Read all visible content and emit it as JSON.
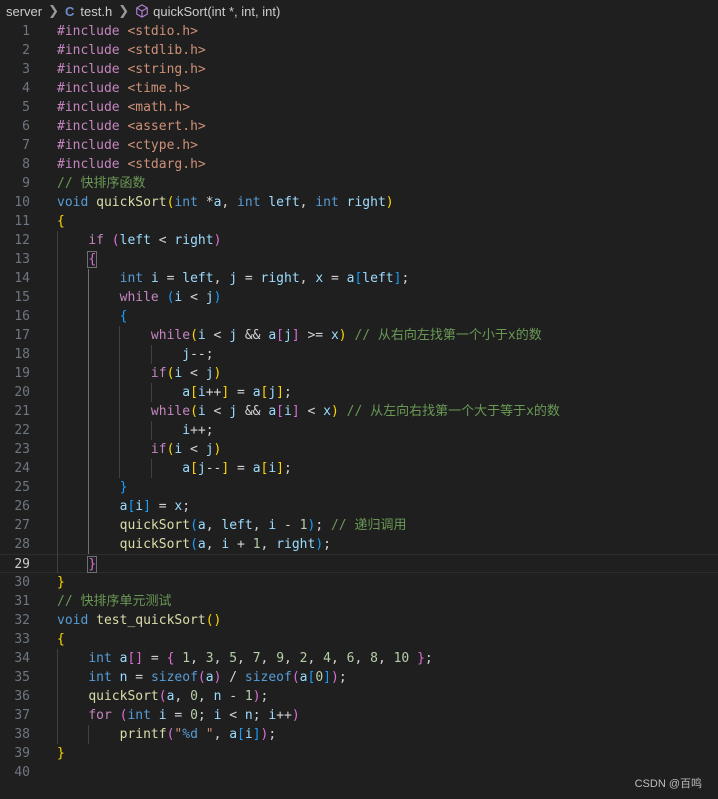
{
  "breadcrumb": {
    "folder": "server",
    "file_icon": "C",
    "file": "test.h",
    "symbol": "quickSort(int *, int, int)"
  },
  "current_line": 29,
  "lines": [
    {
      "n": "1",
      "tokens": [
        [
          "pre",
          "#include"
        ],
        [
          "op",
          " "
        ],
        [
          "inc",
          "<stdio.h>"
        ]
      ]
    },
    {
      "n": "2",
      "tokens": [
        [
          "pre",
          "#include"
        ],
        [
          "op",
          " "
        ],
        [
          "inc",
          "<stdlib.h>"
        ]
      ]
    },
    {
      "n": "3",
      "tokens": [
        [
          "pre",
          "#include"
        ],
        [
          "op",
          " "
        ],
        [
          "inc",
          "<string.h>"
        ]
      ]
    },
    {
      "n": "4",
      "tokens": [
        [
          "pre",
          "#include"
        ],
        [
          "op",
          " "
        ],
        [
          "inc",
          "<time.h>"
        ]
      ]
    },
    {
      "n": "5",
      "tokens": [
        [
          "pre",
          "#include"
        ],
        [
          "op",
          " "
        ],
        [
          "inc",
          "<math.h>"
        ]
      ]
    },
    {
      "n": "6",
      "tokens": [
        [
          "pre",
          "#include"
        ],
        [
          "op",
          " "
        ],
        [
          "inc",
          "<assert.h>"
        ]
      ]
    },
    {
      "n": "7",
      "tokens": [
        [
          "pre",
          "#include"
        ],
        [
          "op",
          " "
        ],
        [
          "inc",
          "<ctype.h>"
        ]
      ]
    },
    {
      "n": "8",
      "tokens": [
        [
          "pre",
          "#include"
        ],
        [
          "op",
          " "
        ],
        [
          "inc",
          "<stdarg.h>"
        ]
      ]
    },
    {
      "n": "9",
      "tokens": [
        [
          "cmt",
          "// 快排序函数"
        ]
      ]
    },
    {
      "n": "10",
      "tokens": [
        [
          "kw",
          "void"
        ],
        [
          "op",
          " "
        ],
        [
          "fn",
          "quickSort"
        ],
        [
          "b1",
          "("
        ],
        [
          "kw",
          "int"
        ],
        [
          "op",
          " *"
        ],
        [
          "var",
          "a"
        ],
        [
          "op",
          ", "
        ],
        [
          "kw",
          "int"
        ],
        [
          "op",
          " "
        ],
        [
          "var",
          "left"
        ],
        [
          "op",
          ", "
        ],
        [
          "kw",
          "int"
        ],
        [
          "op",
          " "
        ],
        [
          "var",
          "right"
        ],
        [
          "b1",
          ")"
        ]
      ]
    },
    {
      "n": "11",
      "tokens": [
        [
          "b1",
          "{"
        ]
      ]
    },
    {
      "n": "12",
      "tokens": [
        [
          "op",
          "    "
        ],
        [
          "ctl",
          "if"
        ],
        [
          "op",
          " "
        ],
        [
          "b2",
          "("
        ],
        [
          "var",
          "left"
        ],
        [
          "op",
          " < "
        ],
        [
          "var",
          "right"
        ],
        [
          "b2",
          ")"
        ]
      ]
    },
    {
      "n": "13",
      "tokens": [
        [
          "op",
          "    "
        ],
        [
          "b2box",
          "{"
        ]
      ]
    },
    {
      "n": "14",
      "tokens": [
        [
          "op",
          "        "
        ],
        [
          "kw",
          "int"
        ],
        [
          "op",
          " "
        ],
        [
          "var",
          "i"
        ],
        [
          "op",
          " = "
        ],
        [
          "var",
          "left"
        ],
        [
          "op",
          ", "
        ],
        [
          "var",
          "j"
        ],
        [
          "op",
          " = "
        ],
        [
          "var",
          "right"
        ],
        [
          "op",
          ", "
        ],
        [
          "var",
          "x"
        ],
        [
          "op",
          " = "
        ],
        [
          "var",
          "a"
        ],
        [
          "b3",
          "["
        ],
        [
          "var",
          "left"
        ],
        [
          "b3",
          "]"
        ],
        [
          "op",
          ";"
        ]
      ]
    },
    {
      "n": "15",
      "tokens": [
        [
          "op",
          "        "
        ],
        [
          "ctl",
          "while"
        ],
        [
          "op",
          " "
        ],
        [
          "b3",
          "("
        ],
        [
          "var",
          "i"
        ],
        [
          "op",
          " < "
        ],
        [
          "var",
          "j"
        ],
        [
          "b3",
          ")"
        ]
      ]
    },
    {
      "n": "16",
      "tokens": [
        [
          "op",
          "        "
        ],
        [
          "b3",
          "{"
        ]
      ]
    },
    {
      "n": "17",
      "tokens": [
        [
          "op",
          "            "
        ],
        [
          "ctl",
          "while"
        ],
        [
          "b1",
          "("
        ],
        [
          "var",
          "i"
        ],
        [
          "op",
          " < "
        ],
        [
          "var",
          "j"
        ],
        [
          "op",
          " && "
        ],
        [
          "var",
          "a"
        ],
        [
          "b2",
          "["
        ],
        [
          "var",
          "j"
        ],
        [
          "b2",
          "]"
        ],
        [
          "op",
          " >= "
        ],
        [
          "var",
          "x"
        ],
        [
          "b1",
          ")"
        ],
        [
          "op",
          " "
        ],
        [
          "cmt",
          "// 从右向左找第一个小于x的数"
        ]
      ]
    },
    {
      "n": "18",
      "tokens": [
        [
          "op",
          "                "
        ],
        [
          "var",
          "j"
        ],
        [
          "op",
          "--;"
        ]
      ]
    },
    {
      "n": "19",
      "tokens": [
        [
          "op",
          "            "
        ],
        [
          "ctl",
          "if"
        ],
        [
          "b1",
          "("
        ],
        [
          "var",
          "i"
        ],
        [
          "op",
          " < "
        ],
        [
          "var",
          "j"
        ],
        [
          "b1",
          ")"
        ]
      ]
    },
    {
      "n": "20",
      "tokens": [
        [
          "op",
          "                "
        ],
        [
          "var",
          "a"
        ],
        [
          "b1",
          "["
        ],
        [
          "var",
          "i"
        ],
        [
          "op",
          "++"
        ],
        [
          "b1",
          "]"
        ],
        [
          "op",
          " = "
        ],
        [
          "var",
          "a"
        ],
        [
          "b1",
          "["
        ],
        [
          "var",
          "j"
        ],
        [
          "b1",
          "]"
        ],
        [
          "op",
          ";"
        ]
      ]
    },
    {
      "n": "21",
      "tokens": [
        [
          "op",
          "            "
        ],
        [
          "ctl",
          "while"
        ],
        [
          "b1",
          "("
        ],
        [
          "var",
          "i"
        ],
        [
          "op",
          " < "
        ],
        [
          "var",
          "j"
        ],
        [
          "op",
          " && "
        ],
        [
          "var",
          "a"
        ],
        [
          "b2",
          "["
        ],
        [
          "var",
          "i"
        ],
        [
          "b2",
          "]"
        ],
        [
          "op",
          " < "
        ],
        [
          "var",
          "x"
        ],
        [
          "b1",
          ")"
        ],
        [
          "op",
          " "
        ],
        [
          "cmt",
          "// 从左向右找第一个大于等于x的数"
        ]
      ]
    },
    {
      "n": "22",
      "tokens": [
        [
          "op",
          "                "
        ],
        [
          "var",
          "i"
        ],
        [
          "op",
          "++;"
        ]
      ]
    },
    {
      "n": "23",
      "tokens": [
        [
          "op",
          "            "
        ],
        [
          "ctl",
          "if"
        ],
        [
          "b1",
          "("
        ],
        [
          "var",
          "i"
        ],
        [
          "op",
          " < "
        ],
        [
          "var",
          "j"
        ],
        [
          "b1",
          ")"
        ]
      ]
    },
    {
      "n": "24",
      "tokens": [
        [
          "op",
          "                "
        ],
        [
          "var",
          "a"
        ],
        [
          "b1",
          "["
        ],
        [
          "var",
          "j"
        ],
        [
          "op",
          "--"
        ],
        [
          "b1",
          "]"
        ],
        [
          "op",
          " = "
        ],
        [
          "var",
          "a"
        ],
        [
          "b1",
          "["
        ],
        [
          "var",
          "i"
        ],
        [
          "b1",
          "]"
        ],
        [
          "op",
          ";"
        ]
      ]
    },
    {
      "n": "25",
      "tokens": [
        [
          "op",
          "        "
        ],
        [
          "b3",
          "}"
        ]
      ]
    },
    {
      "n": "26",
      "tokens": [
        [
          "op",
          "        "
        ],
        [
          "var",
          "a"
        ],
        [
          "b3",
          "["
        ],
        [
          "var",
          "i"
        ],
        [
          "b3",
          "]"
        ],
        [
          "op",
          " = "
        ],
        [
          "var",
          "x"
        ],
        [
          "op",
          ";"
        ]
      ]
    },
    {
      "n": "27",
      "tokens": [
        [
          "op",
          "        "
        ],
        [
          "fn",
          "quickSort"
        ],
        [
          "b3",
          "("
        ],
        [
          "var",
          "a"
        ],
        [
          "op",
          ", "
        ],
        [
          "var",
          "left"
        ],
        [
          "op",
          ", "
        ],
        [
          "var",
          "i"
        ],
        [
          "op",
          " - "
        ],
        [
          "num",
          "1"
        ],
        [
          "b3",
          ")"
        ],
        [
          "op",
          "; "
        ],
        [
          "cmt",
          "// 递归调用"
        ]
      ]
    },
    {
      "n": "28",
      "tokens": [
        [
          "op",
          "        "
        ],
        [
          "fn",
          "quickSort"
        ],
        [
          "b3",
          "("
        ],
        [
          "var",
          "a"
        ],
        [
          "op",
          ", "
        ],
        [
          "var",
          "i"
        ],
        [
          "op",
          " + "
        ],
        [
          "num",
          "1"
        ],
        [
          "op",
          ", "
        ],
        [
          "var",
          "right"
        ],
        [
          "b3",
          ")"
        ],
        [
          "op",
          ";"
        ]
      ]
    },
    {
      "n": "29",
      "tokens": [
        [
          "op",
          "    "
        ],
        [
          "b2box",
          "}"
        ]
      ]
    },
    {
      "n": "30",
      "tokens": [
        [
          "b1",
          "}"
        ]
      ]
    },
    {
      "n": "31",
      "tokens": [
        [
          "cmt",
          "// 快排序单元测试"
        ]
      ]
    },
    {
      "n": "32",
      "tokens": [
        [
          "kw",
          "void"
        ],
        [
          "op",
          " "
        ],
        [
          "fn",
          "test_quickSort"
        ],
        [
          "b1",
          "()"
        ]
      ]
    },
    {
      "n": "33",
      "tokens": [
        [
          "b1",
          "{"
        ]
      ]
    },
    {
      "n": "34",
      "tokens": [
        [
          "op",
          "    "
        ],
        [
          "kw",
          "int"
        ],
        [
          "op",
          " "
        ],
        [
          "var",
          "a"
        ],
        [
          "b2",
          "[]"
        ],
        [
          "op",
          " = "
        ],
        [
          "b2",
          "{"
        ],
        [
          "op",
          " "
        ],
        [
          "num",
          "1"
        ],
        [
          "op",
          ", "
        ],
        [
          "num",
          "3"
        ],
        [
          "op",
          ", "
        ],
        [
          "num",
          "5"
        ],
        [
          "op",
          ", "
        ],
        [
          "num",
          "7"
        ],
        [
          "op",
          ", "
        ],
        [
          "num",
          "9"
        ],
        [
          "op",
          ", "
        ],
        [
          "num",
          "2"
        ],
        [
          "op",
          ", "
        ],
        [
          "num",
          "4"
        ],
        [
          "op",
          ", "
        ],
        [
          "num",
          "6"
        ],
        [
          "op",
          ", "
        ],
        [
          "num",
          "8"
        ],
        [
          "op",
          ", "
        ],
        [
          "num",
          "10"
        ],
        [
          "op",
          " "
        ],
        [
          "b2",
          "}"
        ],
        [
          "op",
          ";"
        ]
      ]
    },
    {
      "n": "35",
      "tokens": [
        [
          "op",
          "    "
        ],
        [
          "kw",
          "int"
        ],
        [
          "op",
          " "
        ],
        [
          "var",
          "n"
        ],
        [
          "op",
          " = "
        ],
        [
          "kw",
          "sizeof"
        ],
        [
          "b2",
          "("
        ],
        [
          "var",
          "a"
        ],
        [
          "b2",
          ")"
        ],
        [
          "op",
          " / "
        ],
        [
          "kw",
          "sizeof"
        ],
        [
          "b2",
          "("
        ],
        [
          "var",
          "a"
        ],
        [
          "b3",
          "["
        ],
        [
          "num",
          "0"
        ],
        [
          "b3",
          "]"
        ],
        [
          "b2",
          ")"
        ],
        [
          "op",
          ";"
        ]
      ]
    },
    {
      "n": "36",
      "tokens": [
        [
          "op",
          "    "
        ],
        [
          "fn",
          "quickSort"
        ],
        [
          "b2",
          "("
        ],
        [
          "var",
          "a"
        ],
        [
          "op",
          ", "
        ],
        [
          "num",
          "0"
        ],
        [
          "op",
          ", "
        ],
        [
          "var",
          "n"
        ],
        [
          "op",
          " - "
        ],
        [
          "num",
          "1"
        ],
        [
          "b2",
          ")"
        ],
        [
          "op",
          ";"
        ]
      ]
    },
    {
      "n": "37",
      "tokens": [
        [
          "op",
          "    "
        ],
        [
          "ctl",
          "for"
        ],
        [
          "op",
          " "
        ],
        [
          "b2",
          "("
        ],
        [
          "kw",
          "int"
        ],
        [
          "op",
          " "
        ],
        [
          "var",
          "i"
        ],
        [
          "op",
          " = "
        ],
        [
          "num",
          "0"
        ],
        [
          "op",
          "; "
        ],
        [
          "var",
          "i"
        ],
        [
          "op",
          " < "
        ],
        [
          "var",
          "n"
        ],
        [
          "op",
          "; "
        ],
        [
          "var",
          "i"
        ],
        [
          "op",
          "++"
        ],
        [
          "b2",
          ")"
        ]
      ]
    },
    {
      "n": "38",
      "tokens": [
        [
          "op",
          "        "
        ],
        [
          "fn",
          "printf"
        ],
        [
          "b2",
          "("
        ],
        [
          "str",
          "\""
        ],
        [
          "fmt",
          "%d"
        ],
        [
          "str",
          " \""
        ],
        [
          "op",
          ", "
        ],
        [
          "var",
          "a"
        ],
        [
          "b3",
          "["
        ],
        [
          "var",
          "i"
        ],
        [
          "b3",
          "]"
        ],
        [
          "b2",
          ")"
        ],
        [
          "op",
          ";"
        ]
      ]
    },
    {
      "n": "39",
      "tokens": [
        [
          "b1",
          "}"
        ]
      ]
    },
    {
      "n": "40",
      "tokens": []
    }
  ],
  "watermark": "CSDN @百鸣"
}
